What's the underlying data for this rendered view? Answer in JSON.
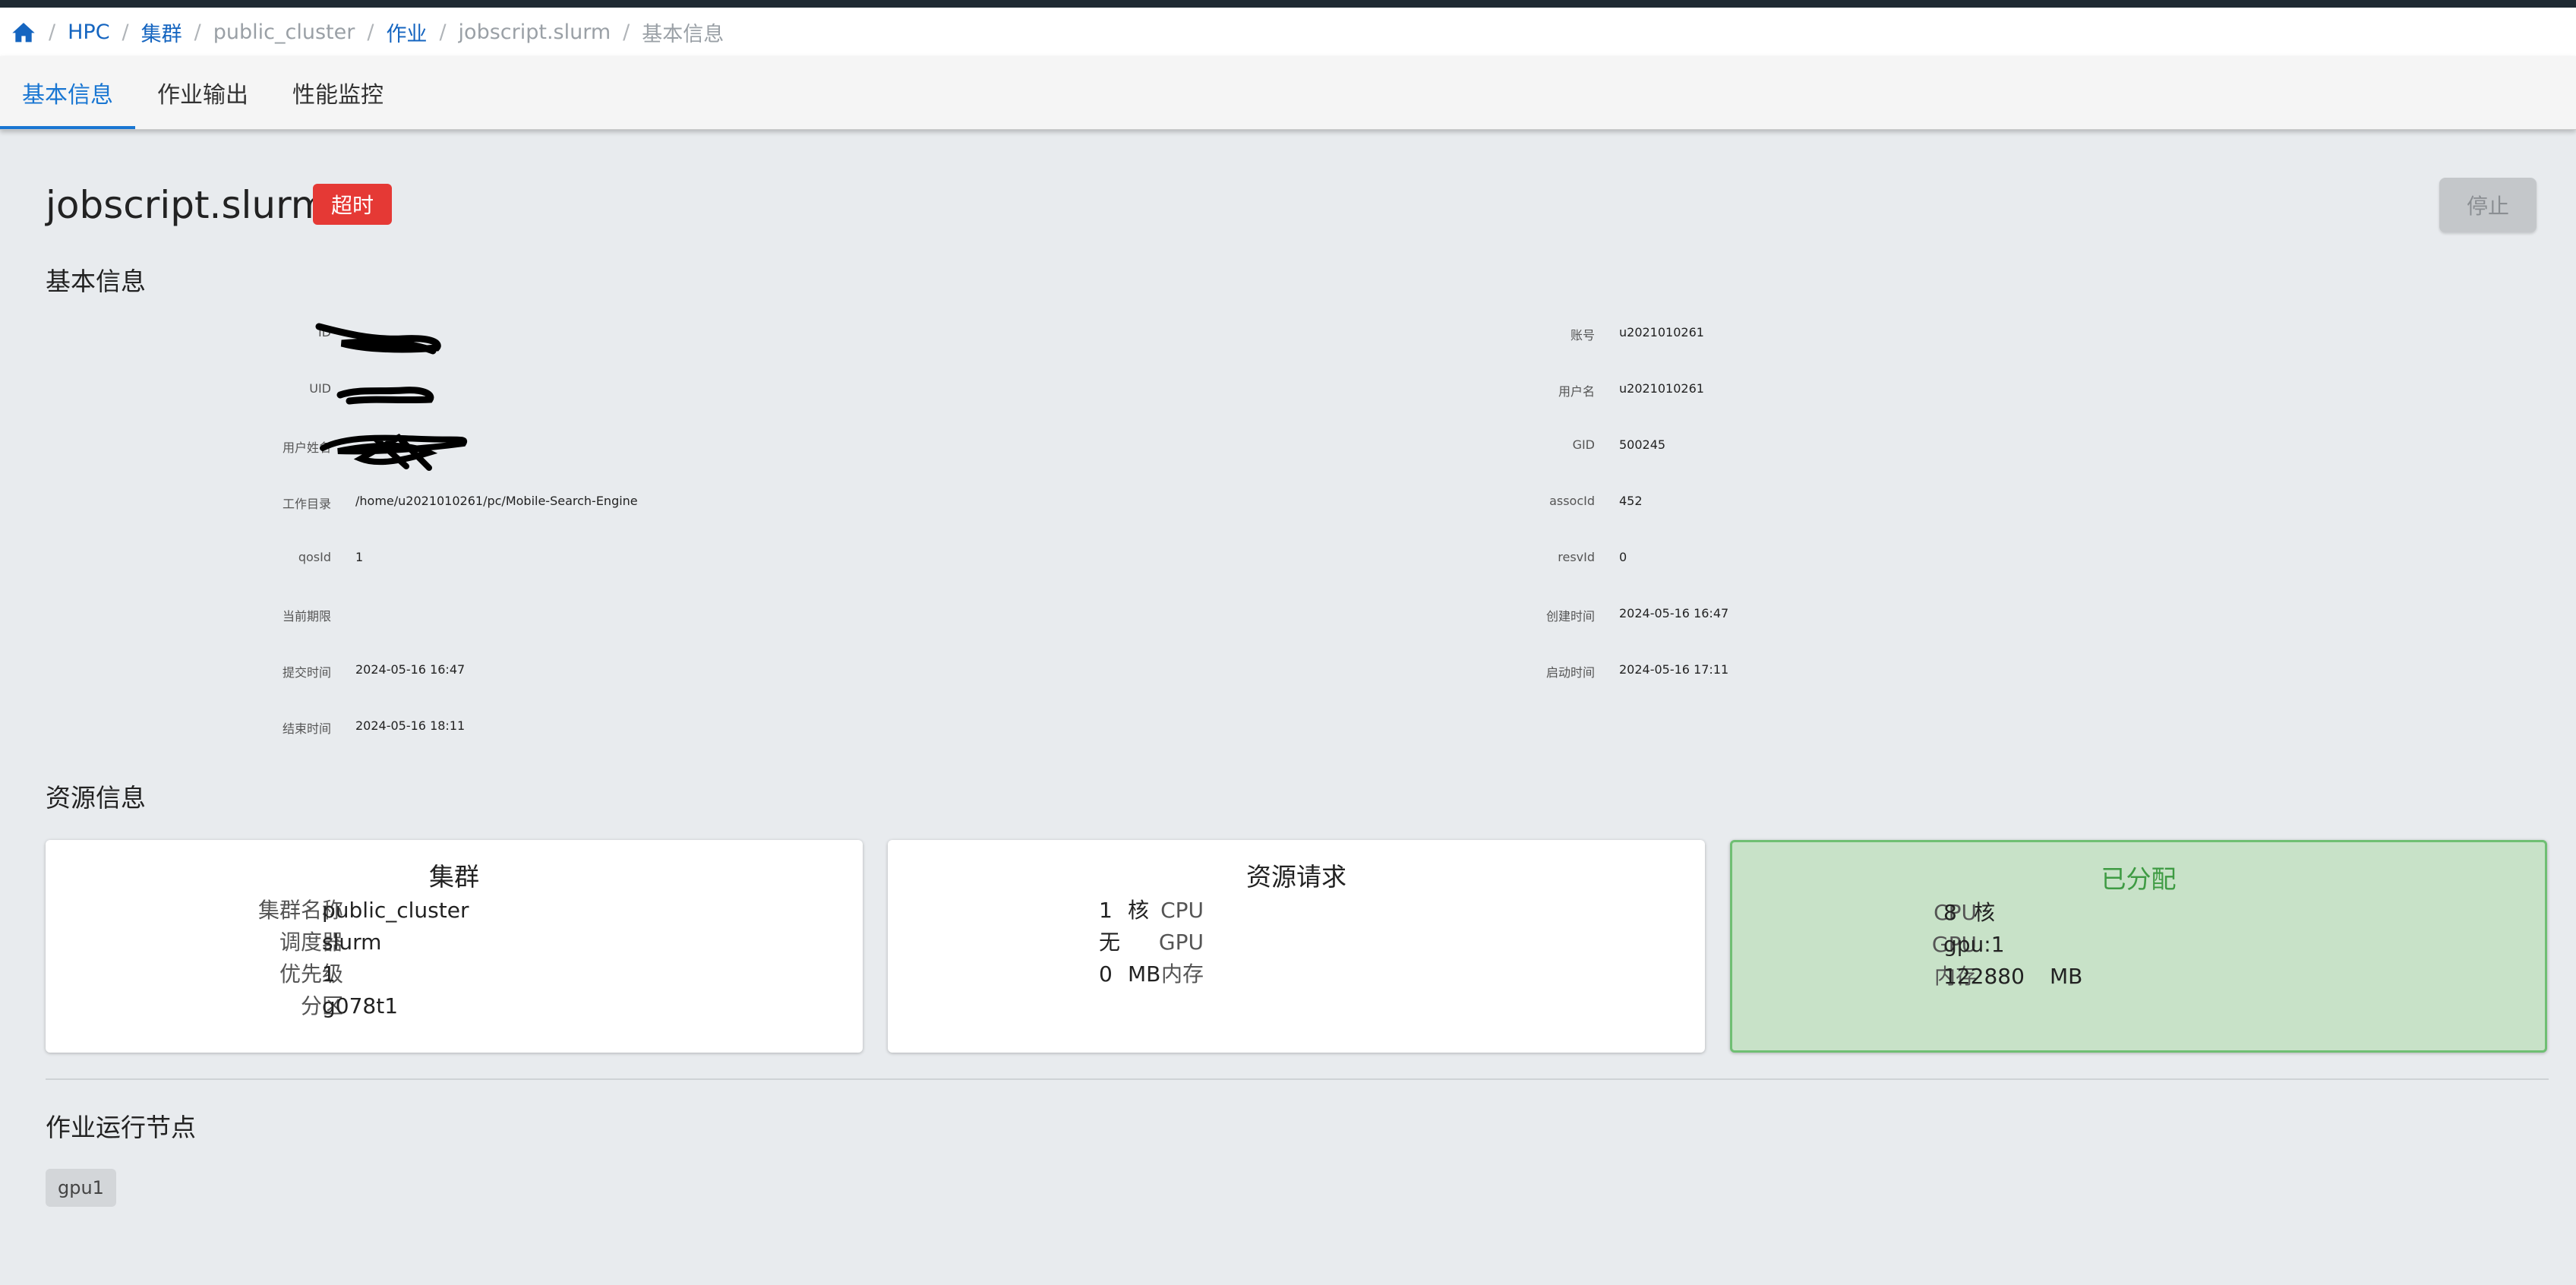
{
  "breadcrumb": {
    "items": [
      "HPC",
      "集群",
      "public_cluster",
      "作业",
      "jobscript.slurm",
      "基本信息"
    ]
  },
  "tabs": [
    "基本信息",
    "作业输出",
    "性能监控"
  ],
  "job": {
    "title": "jobscript.slurm",
    "status_badge": "超时",
    "stop_button": "停止"
  },
  "sections": {
    "basic": "基本信息",
    "resources": "资源信息",
    "nodes": "作业运行节点"
  },
  "basic_info": {
    "left": [
      {
        "label": "ID",
        "value": ""
      },
      {
        "label": "UID",
        "value": ""
      },
      {
        "label": "用户姓名",
        "value": ""
      },
      {
        "label": "工作目录",
        "value": "/home/u2021010261/pc/Mobile-Search-Engine"
      },
      {
        "label": "qosId",
        "value": "1"
      },
      {
        "label": "当前期限",
        "value": ""
      },
      {
        "label": "提交时间",
        "value": "2024-05-16 16:47"
      },
      {
        "label": "结束时间",
        "value": "2024-05-16 18:11"
      }
    ],
    "right": [
      {
        "label": "账号",
        "value": "u2021010261"
      },
      {
        "label": "用户名",
        "value": "u2021010261"
      },
      {
        "label": "GID",
        "value": "500245"
      },
      {
        "label": "assocId",
        "value": "452"
      },
      {
        "label": "resvId",
        "value": "0"
      },
      {
        "label": "创建时间",
        "value": "2024-05-16 16:47"
      },
      {
        "label": "启动时间",
        "value": "2024-05-16 17:11"
      }
    ]
  },
  "cards": {
    "cluster": {
      "title": "集群",
      "rows": [
        {
          "label": "集群名称",
          "value": "public_cluster"
        },
        {
          "label": "调度器",
          "value": "slurm"
        },
        {
          "label": "优先级",
          "value": "1"
        },
        {
          "label": "分区",
          "value": "g078t1"
        }
      ]
    },
    "request": {
      "title": "资源请求",
      "rows": [
        {
          "label": "CPU",
          "value": "1",
          "unit": "核"
        },
        {
          "label": "GPU",
          "value": "无",
          "unit": ""
        },
        {
          "label": "内存",
          "value": "0",
          "unit": "MB"
        }
      ]
    },
    "allocated": {
      "title": "已分配",
      "rows": [
        {
          "label": "CPU",
          "value": "8",
          "unit": "核"
        },
        {
          "label": "GPU",
          "value": "gpu:1",
          "unit": ""
        },
        {
          "label": "内存",
          "value": "122880",
          "unit": "MB"
        }
      ]
    }
  },
  "nodes": [
    "gpu1"
  ],
  "colors": {
    "accent": "#1976d2",
    "danger": "#e53935",
    "allocated_bg": "#c8e2c8",
    "allocated_text": "#3e9b43"
  }
}
